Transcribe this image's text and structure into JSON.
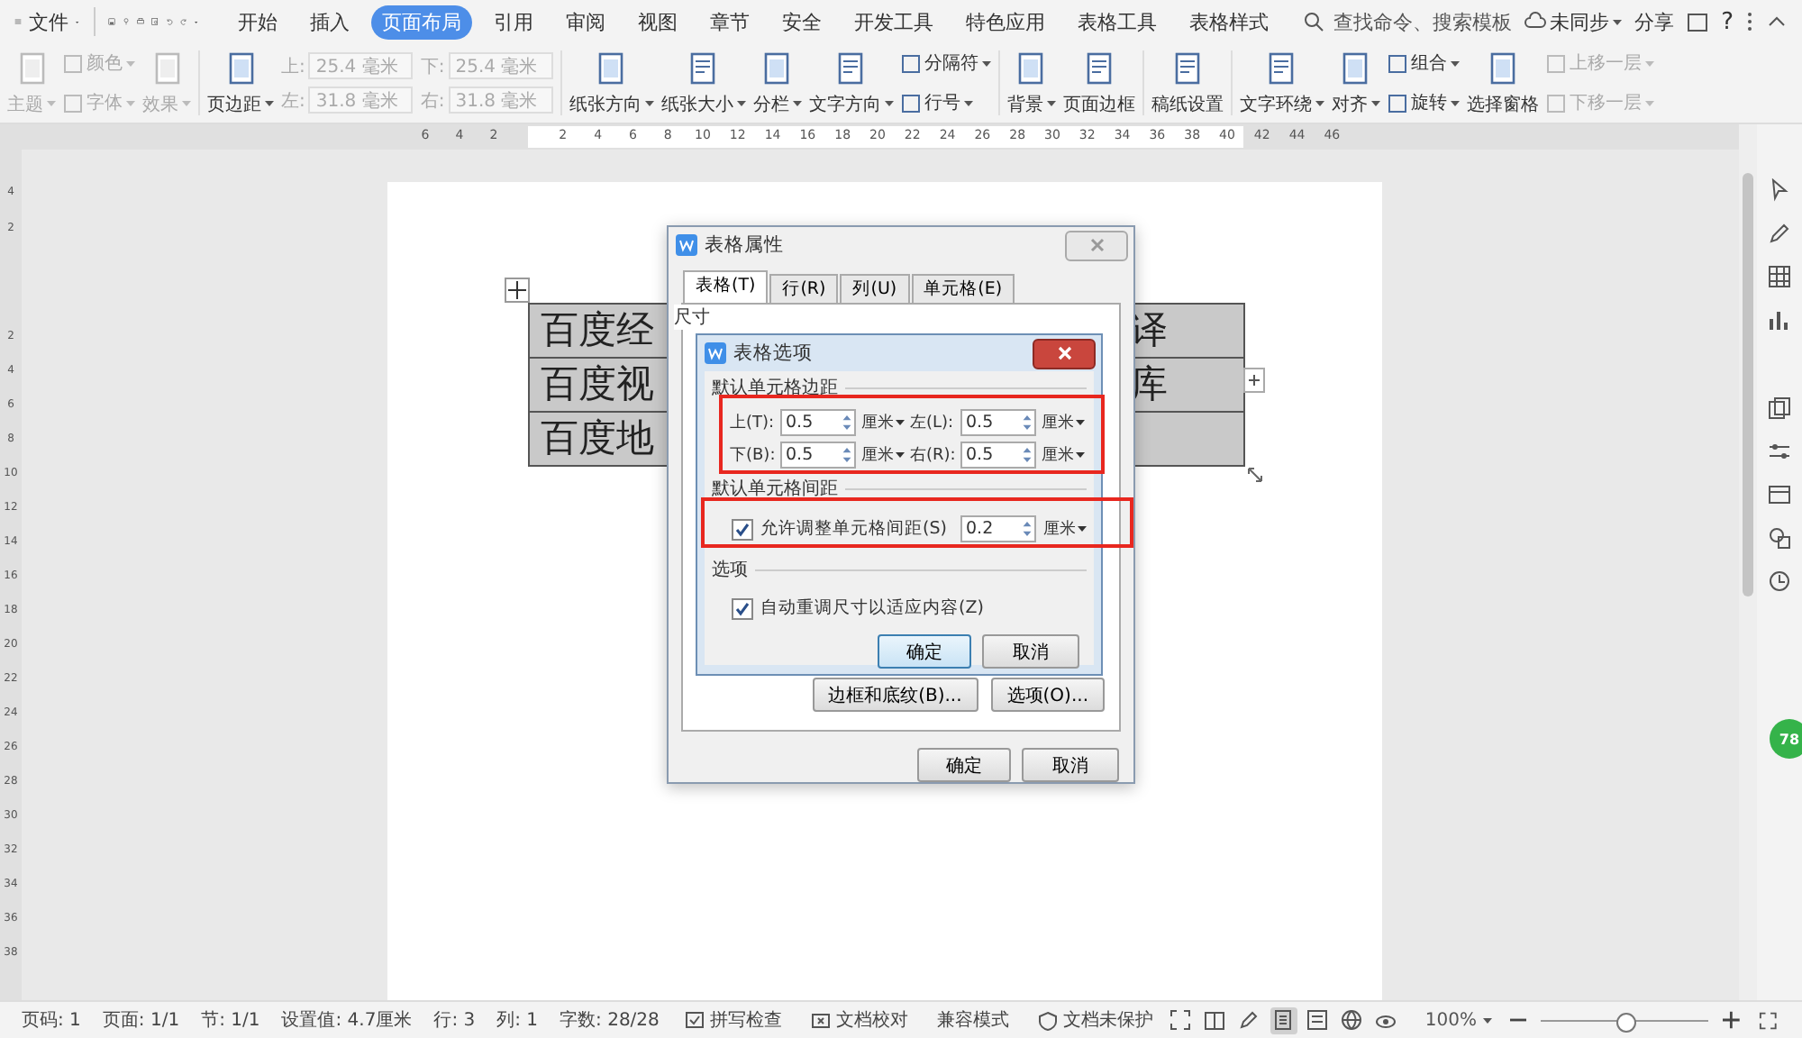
{
  "menu_bar": {
    "file_menu": "文件",
    "tabs": [
      {
        "label": "开始",
        "selected": false
      },
      {
        "label": "插入",
        "selected": false
      },
      {
        "label": "页面布局",
        "selected": true
      },
      {
        "label": "引用",
        "selected": false
      },
      {
        "label": "审阅",
        "selected": false
      },
      {
        "label": "视图",
        "selected": false
      },
      {
        "label": "章节",
        "selected": false
      },
      {
        "label": "安全",
        "selected": false
      },
      {
        "label": "开发工具",
        "selected": false
      },
      {
        "label": "特色应用",
        "selected": false
      },
      {
        "label": "表格工具",
        "selected": false
      },
      {
        "label": "表格样式",
        "selected": false
      }
    ],
    "search": {
      "placeholder": "查找命令、搜索模板"
    },
    "sync": "未同步",
    "share": "分享",
    "help": "?"
  },
  "ribbon": [
    {
      "kind": "large",
      "label": "主题",
      "dropdown": true,
      "disabled": true
    },
    {
      "kind": "stack",
      "items": [
        {
          "label": "颜色",
          "dropdown": true,
          "disabled": true
        },
        {
          "label": "字体",
          "dropdown": true,
          "disabled": true
        }
      ]
    },
    {
      "kind": "large",
      "label": "效果",
      "dropdown": true,
      "disabled": true
    },
    {
      "kind": "separator"
    },
    {
      "kind": "large",
      "label": "页边距",
      "dropdown": true,
      "disabled": false
    },
    {
      "kind": "fields",
      "disabled": true,
      "items": [
        {
          "label": "上:",
          "value": "25.4 毫米"
        },
        {
          "label": "左:",
          "value": "31.8 毫米"
        }
      ]
    },
    {
      "kind": "fields",
      "disabled": true,
      "items": [
        {
          "label": "下:",
          "value": "25.4 毫米"
        },
        {
          "label": "右:",
          "value": "31.8 毫米"
        }
      ]
    },
    {
      "kind": "separator"
    },
    {
      "kind": "large",
      "label": "纸张方向",
      "dropdown": true,
      "disabled": false
    },
    {
      "kind": "large",
      "label": "纸张大小",
      "dropdown": true,
      "disabled": false
    },
    {
      "kind": "large",
      "label": "分栏",
      "dropdown": true,
      "disabled": false
    },
    {
      "kind": "large",
      "label": "文字方向",
      "dropdown": true,
      "disabled": false
    },
    {
      "kind": "stack",
      "items": [
        {
          "label": "分隔符",
          "dropdown": true,
          "disabled": false
        },
        {
          "label": "行号",
          "dropdown": true,
          "disabled": false
        }
      ]
    },
    {
      "kind": "separator"
    },
    {
      "kind": "large",
      "label": "背景",
      "dropdown": true,
      "disabled": false
    },
    {
      "kind": "large",
      "label": "页面边框",
      "dropdown": false,
      "disabled": false
    },
    {
      "kind": "separator"
    },
    {
      "kind": "large",
      "label": "稿纸设置",
      "dropdown": false,
      "disabled": false
    },
    {
      "kind": "separator"
    },
    {
      "kind": "large",
      "label": "文字环绕",
      "dropdown": true,
      "disabled": false
    },
    {
      "kind": "large",
      "label": "对齐",
      "dropdown": true,
      "disabled": false
    },
    {
      "kind": "stack",
      "items": [
        {
          "label": "组合",
          "dropdown": true,
          "disabled": false
        },
        {
          "label": "旋转",
          "dropdown": true,
          "disabled": false
        }
      ]
    },
    {
      "kind": "large",
      "label": "选择窗格",
      "dropdown": false,
      "disabled": false
    },
    {
      "kind": "stack",
      "items": [
        {
          "label": "上移一层",
          "dropdown": true,
          "disabled": true
        },
        {
          "label": "下移一层",
          "dropdown": true,
          "disabled": true
        }
      ]
    }
  ],
  "ruler": {
    "left_labels": [
      "6",
      "4",
      "2"
    ],
    "labels": [
      "2",
      "4",
      "6",
      "8",
      "10",
      "12",
      "14",
      "16",
      "18",
      "20",
      "22",
      "24",
      "26",
      "28",
      "30",
      "32",
      "34",
      "36",
      "38",
      "40",
      "42",
      "44",
      "46"
    ],
    "side_top_labels": [
      "4",
      "2"
    ],
    "side_labels": [
      "2",
      "4",
      "6",
      "8",
      "10",
      "12",
      "14",
      "16",
      "18",
      "20",
      "22",
      "24",
      "26",
      "28",
      "30",
      "32",
      "34",
      "36",
      "38"
    ]
  },
  "document": {
    "table": {
      "rows": [
        {
          "cells": [
            "百度经",
            "译"
          ]
        },
        {
          "cells": [
            "百度视",
            "库"
          ]
        },
        {
          "cells": [
            "百度地"
          ]
        }
      ]
    }
  },
  "table_properties_dialog": {
    "title": "表格属性",
    "tabs": [
      {
        "label": "表格(T)",
        "selected": true
      },
      {
        "label": "行(R)",
        "selected": false
      },
      {
        "label": "列(U)",
        "selected": false
      },
      {
        "label": "单元格(E)",
        "selected": false
      }
    ],
    "section": "尺寸",
    "buttons": [
      "边框和底纹(B)...",
      "选项(O)..."
    ],
    "ok": "确定",
    "cancel": "取消"
  },
  "table_options_dialog": {
    "title": "表格选项",
    "margins_section": "默认单元格边距",
    "margins": [
      {
        "label": "上(T):",
        "value": "0.5",
        "unit": "厘米"
      },
      {
        "label": "左(L):",
        "value": "0.5",
        "unit": "厘米"
      },
      {
        "label": "下(B):",
        "value": "0.5",
        "unit": "厘米"
      },
      {
        "label": "右(R):",
        "value": "0.5",
        "unit": "厘米"
      }
    ],
    "spacing_section": "默认单元格间距",
    "spacing": {
      "label": "允许调整单元格间距(S)",
      "checked": true,
      "value": "0.2",
      "unit": "厘米"
    },
    "options_section": "选项",
    "autofit": {
      "label": "自动重调尺寸以适应内容(Z)",
      "checked": true
    },
    "ok": "确定",
    "cancel": "取消"
  },
  "sidebar": {
    "badge": "78"
  },
  "status_bar": {
    "items": [
      "页码: 1",
      "页面: 1/1",
      "节: 1/1",
      "设置值: 4.7厘米",
      "行: 3",
      "列: 1",
      "字数: 28/28"
    ],
    "tools": [
      {
        "kind": "spell",
        "label": "拼写检查"
      },
      {
        "kind": "proof",
        "label": "文档校对"
      },
      {
        "kind": "plain",
        "label": "兼容模式"
      },
      {
        "kind": "shield",
        "label": "文档未保护"
      }
    ],
    "view_modes": [
      {
        "selected": false
      },
      {
        "selected": false
      },
      {
        "selected": false
      },
      {
        "selected": true
      },
      {
        "selected": false
      },
      {
        "selected": false
      },
      {
        "selected": false
      }
    ],
    "zoom": "100%",
    "zoom_slider": {
      "level": 0.5
    }
  }
}
